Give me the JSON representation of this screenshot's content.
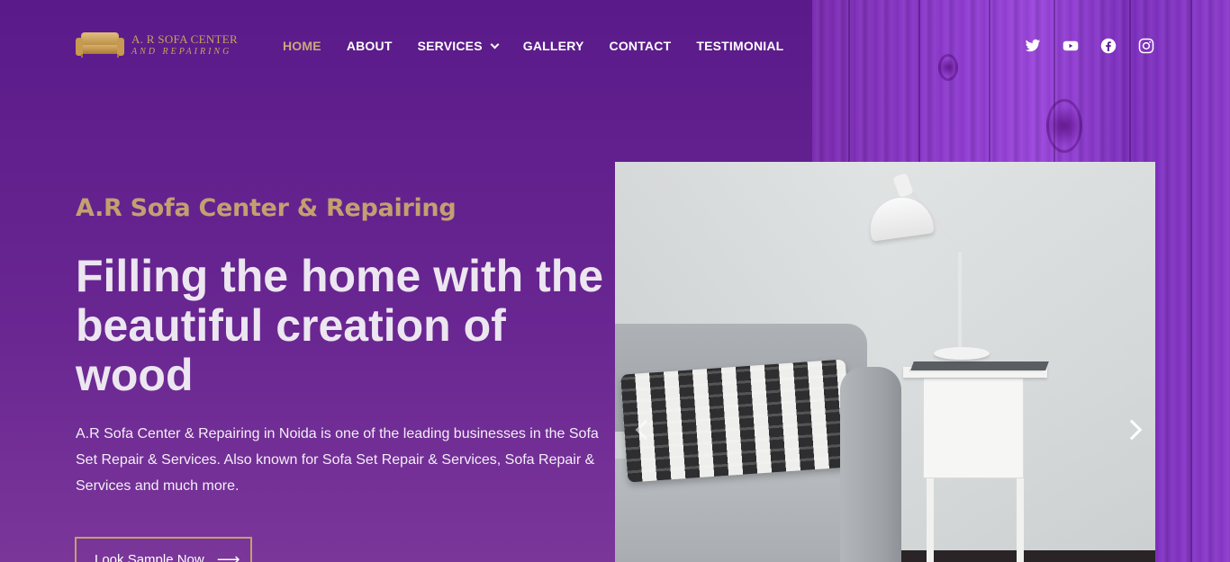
{
  "brand": {
    "line1": "A. R SOFA CENTER",
    "line2": "AND REPAIRING",
    "icon": "sofa-logo-icon",
    "color": "#c9a25e"
  },
  "nav": {
    "items": [
      {
        "label": "HOME",
        "active": true
      },
      {
        "label": "ABOUT"
      },
      {
        "label": "SERVICES",
        "has_dropdown": true
      },
      {
        "label": "GALLERY"
      },
      {
        "label": "CONTACT"
      },
      {
        "label": "TESTIMONIAL"
      }
    ],
    "active_color": "#c9a97c"
  },
  "social": {
    "icons": [
      "twitter-icon",
      "youtube-icon",
      "facebook-icon",
      "instagram-icon"
    ]
  },
  "hero": {
    "subtitle": "A.R Sofa Center & Repairing",
    "headline": "Filling the home with the beautiful creation of wood",
    "description": "A.R Sofa Center & Repairing in Noida is one of the leading businesses in the Sofa Set Repair & Services. Also known for Sofa Set Repair & Services, Sofa Repair & Services and much more.",
    "cta_label": "Look Sample Now",
    "cta_arrow": "⟶",
    "accent_color": "#c3a070",
    "background_color": "#5a1a8a"
  },
  "slider": {
    "prev_icon": "chevron-left-icon",
    "next_icon": "chevron-right-icon"
  }
}
